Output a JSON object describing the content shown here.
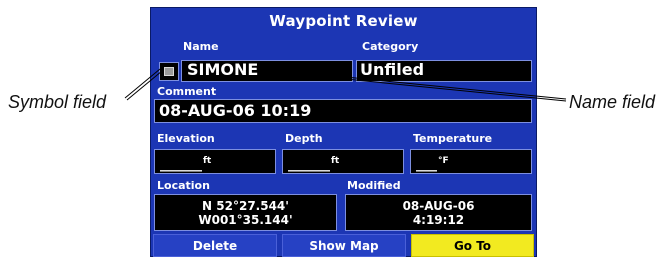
{
  "callouts": {
    "symbol_field": "Symbol field",
    "name_field": "Name field"
  },
  "screen": {
    "title": "Waypoint Review",
    "name": {
      "label": "Name",
      "value": "SIMONE",
      "symbol_icon": "waypoint-symbol-icon"
    },
    "category": {
      "label": "Category",
      "value": "Unfiled"
    },
    "comment": {
      "label": "Comment",
      "value": "08-AUG-06 10:19"
    },
    "elevation": {
      "label": "Elevation",
      "value": "______",
      "unit": "ft"
    },
    "depth": {
      "label": "Depth",
      "value": "______",
      "unit": "ft"
    },
    "temperature": {
      "label": "Temperature",
      "value": "___",
      "unit": "°F"
    },
    "location": {
      "label": "Location",
      "lat": "N  52°27.544'",
      "lon": "W001°35.144'"
    },
    "modified": {
      "label": "Modified",
      "date": "08-AUG-06",
      "time": "4:19:12"
    },
    "buttons": {
      "delete": "Delete",
      "show_map": "Show Map",
      "go_to": "Go To"
    }
  },
  "colors": {
    "screen_bg": "#1c36b4",
    "field_bg": "#000000",
    "active_button": "#f2ea20"
  }
}
